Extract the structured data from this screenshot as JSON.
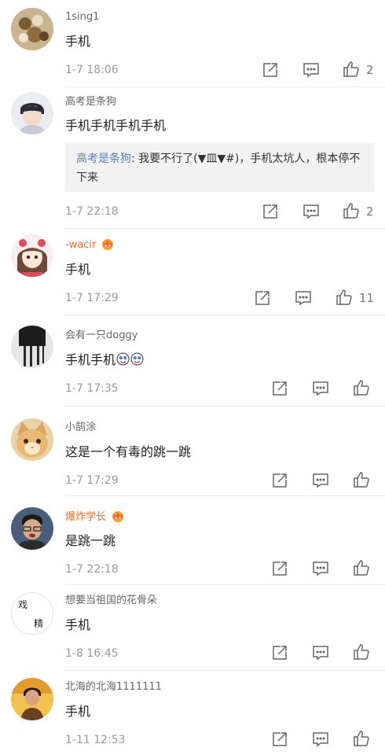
{
  "comments": [
    {
      "username": "1sing1",
      "text": "手机",
      "time": "1-7 18:06",
      "likes": "2",
      "vip": false
    },
    {
      "username": "高考是条狗",
      "text": "手机手机手机手机",
      "time": "1-7 22:18",
      "likes": "2",
      "vip": false,
      "reply": {
        "author": "高考是条狗",
        "text": ": 我要不行了(▼皿▼#)，手机太坑人，根本停不下来"
      }
    },
    {
      "username": "-wacir",
      "text": "手机",
      "time": "1-7 17:29",
      "likes": "11",
      "vip": true
    },
    {
      "username": "会有一只doggy",
      "text": "手机手机",
      "time": "1-7 17:35",
      "likes": "",
      "vip": false
    },
    {
      "username": "小鹄涂",
      "text": "这是一个有毒的跳一跳",
      "time": "1-7 17:29",
      "likes": "",
      "vip": false
    },
    {
      "username": "爆炸学长",
      "text": "是跳一跳",
      "time": "1-7 22:18",
      "likes": "",
      "vip": true
    },
    {
      "username": "想要当祖国的花骨朵",
      "text": "手机",
      "time": "1-8 16:45",
      "likes": "",
      "vip": false,
      "avatar_chars": [
        "戏",
        "精"
      ]
    },
    {
      "username": "北海的北海1111111",
      "text": "手机",
      "time": "1-11 12:53",
      "likes": "",
      "vip": false
    }
  ],
  "icons": {
    "share": "share-icon",
    "comment": "comment-icon",
    "like": "thumbs-up-icon",
    "vip": "crown-badge-icon",
    "emoji": "emoji-icon"
  },
  "colors": {
    "vip_name": "#ee6f2d",
    "reply_name": "#5b7fb5",
    "reply_bg": "#f2f2f2"
  }
}
